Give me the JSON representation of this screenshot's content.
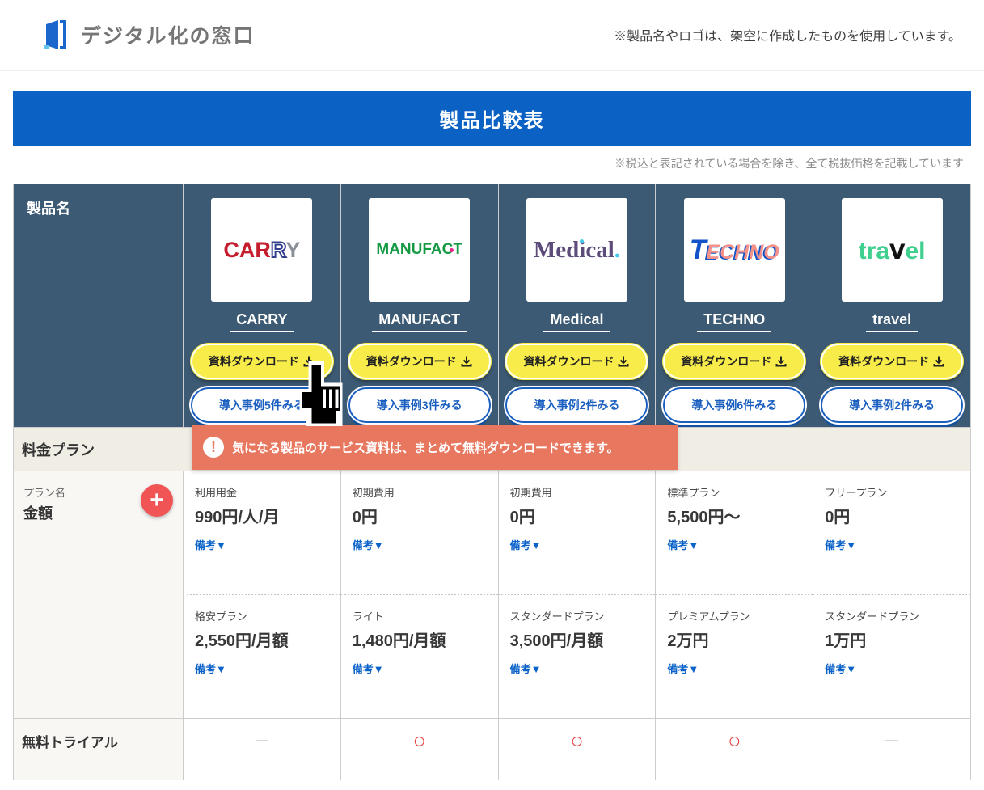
{
  "header": {
    "logo_text": "デジタル化の窓口",
    "disclaimer": "※製品名やロゴは、架空に作成したものを使用しています。"
  },
  "banner": {
    "title": "製品比較表"
  },
  "notes": {
    "tax": "※税込と表記されている場合を除き、全て税抜価格を記載しています"
  },
  "icons": {
    "alert": "!",
    "plus": "+"
  },
  "table": {
    "col_header": "製品名",
    "download_label": "資料ダウンロード",
    "products": [
      {
        "name": "CARRY",
        "logo": [
          "CAR",
          "R",
          "Y"
        ],
        "cases_label": "導入事例5件みる"
      },
      {
        "name": "MANUFACT",
        "logo": [
          "MANUFA",
          "C",
          "T"
        ],
        "cases_label": "導入事例3件みる"
      },
      {
        "name": "Medical",
        "logo": [
          "Med",
          "i",
          "cal",
          "."
        ],
        "cases_label": "導入事例2件みる"
      },
      {
        "name": "TECHNO",
        "logo": [
          "T",
          "ECHNO"
        ],
        "cases_label": "導入事例6件みる"
      },
      {
        "name": "travel",
        "logo": [
          "tra",
          "v",
          "el"
        ],
        "cases_label": "導入事例2件みる"
      }
    ],
    "tooltip": "気になる製品のサービス資料は、まとめて無料ダウンロードできます。",
    "section_price": "料金プラン",
    "plan_row_label": {
      "small": "プラン名",
      "big": "金額"
    },
    "remarks": "備考▼",
    "pricing_row1": [
      {
        "plan": "利用用金",
        "price": "990円/人/月"
      },
      {
        "plan": "初期費用",
        "price": "0円"
      },
      {
        "plan": "初期費用",
        "price": "0円"
      },
      {
        "plan": "標準プラン",
        "price": "5,500円～"
      },
      {
        "plan": "フリープラン",
        "price": "0円"
      }
    ],
    "pricing_row2": [
      {
        "plan": "格安プラン",
        "price": "2,550円/月額"
      },
      {
        "plan": "ライト",
        "price": "1,480円/月額"
      },
      {
        "plan": "スタンダードプラン",
        "price": "3,500円/月額"
      },
      {
        "plan": "プレミアムプラン",
        "price": "2万円"
      },
      {
        "plan": "スタンダードプラン",
        "price": "1万円"
      }
    ],
    "trial": {
      "label": "無料トライアル",
      "values": [
        "—",
        "○",
        "○",
        "○",
        "—"
      ]
    }
  },
  "colors": {
    "accent_blue": "#0c61c4",
    "header_dark": "#3d5a74",
    "alert_salmon": "#e8775f",
    "button_yellow": "#f7ec49",
    "link_blue": "#0b62c9",
    "mark_red": "#e84343"
  }
}
